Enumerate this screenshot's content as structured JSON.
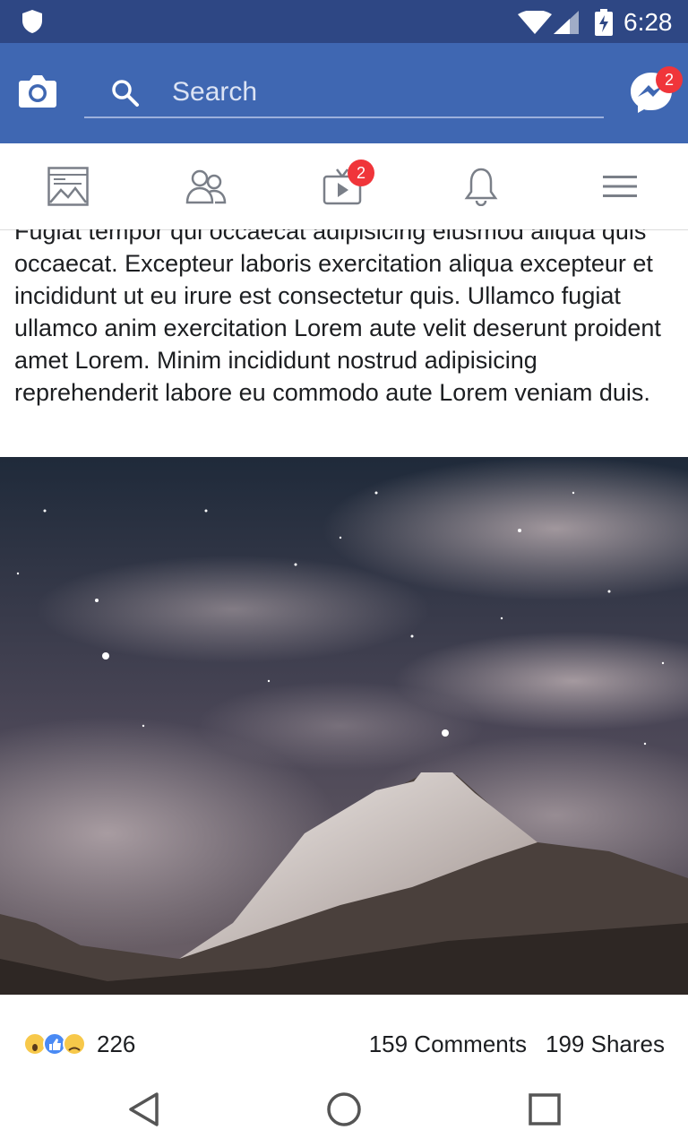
{
  "status_bar": {
    "time": "6:28"
  },
  "app_bar": {
    "search_placeholder": "Search",
    "messenger_badge": "2"
  },
  "tabs": [
    {
      "name": "news-feed",
      "icon": "newspaper-icon"
    },
    {
      "name": "friends",
      "icon": "friends-icon"
    },
    {
      "name": "watch",
      "icon": "video-icon",
      "badge": "2"
    },
    {
      "name": "notifications",
      "icon": "bell-icon"
    },
    {
      "name": "menu",
      "icon": "hamburger-menu-icon"
    }
  ],
  "post": {
    "text": "Fugiat tempor qui occaecat adipisicing eiusmod aliqua quis occaecat. Excepteur laboris exercitation aliqua excepteur et incididunt ut eu irure est consectetur quis. Ullamco fugiat ullamco anim exercitation Lorem aute velit deserunt proident amet Lorem. Minim incididunt nostrud adipisicing reprehenderit labore eu commodo aute Lorem veniam duis.",
    "image": "night-sky-mountain-photo",
    "reaction_count": "226",
    "comments": "159 Comments",
    "shares": "199 Shares"
  },
  "nav": {
    "back": "back-icon",
    "home": "home-icon",
    "recents": "recents-icon"
  },
  "colors": {
    "status_bar": "#2e4784",
    "app_bar": "#3f67b2",
    "badge": "#f0353a"
  }
}
